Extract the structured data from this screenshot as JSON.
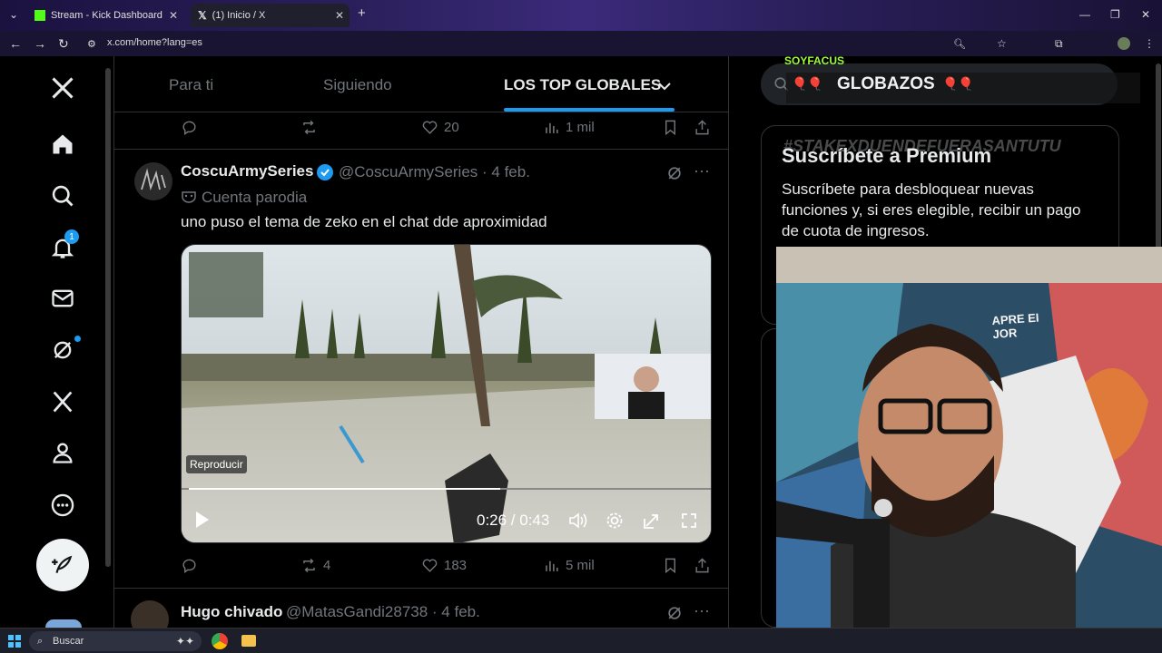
{
  "browser": {
    "tabs": [
      {
        "title": "Stream - Kick Dashboard",
        "icon": "kick-icon"
      },
      {
        "title": "(1) Inicio / X",
        "icon": "x-logo-icon"
      }
    ],
    "url": "x.com/home?lang=es"
  },
  "sidebar": {
    "notifications_badge": "1"
  },
  "feed": {
    "tabs": [
      {
        "label": "Para ti"
      },
      {
        "label": "Siguiendo"
      },
      {
        "label": "LOS TOP GLOBALES"
      }
    ],
    "prev_actions": {
      "reposts": "",
      "likes": "20",
      "views": "1 mil"
    },
    "tweets": [
      {
        "name": "CoscuArmySeries",
        "handle": "@CoscuArmySeries · 4 feb.",
        "parody": "Cuenta parodia",
        "text": "uno  puso el tema de zeko en el chat dde aproximidad",
        "video": {
          "tooltip": "Reproducir",
          "time": "0:26 / 0:43",
          "progress": 0.6
        },
        "actions": {
          "replies": "",
          "reposts": "4",
          "likes": "183",
          "views": "5 mil"
        }
      },
      {
        "name": "Hugo chivado",
        "handle": "@MatasGandi28738 · 4 feb."
      }
    ]
  },
  "right": {
    "premium": {
      "overlay_text": "#STAKEXDUENDEFUERASANTUTU",
      "title": "Suscríbete a Premium",
      "body": "Suscríbete para desbloquear nuevas funciones y, si eres elegible, recibir un pago de cuota de ingresos."
    }
  },
  "stream_overlay": {
    "user": "SOYFACUS",
    "title": "GLOBAZOS"
  },
  "webcam": {
    "wall_text": "APRE EI JOR"
  },
  "taskbar": {
    "search_label": "Buscar"
  },
  "colors": {
    "accent": "#1d9bf0",
    "text": "#e7e9ea",
    "muted": "#71767b",
    "border": "#2f3336"
  }
}
